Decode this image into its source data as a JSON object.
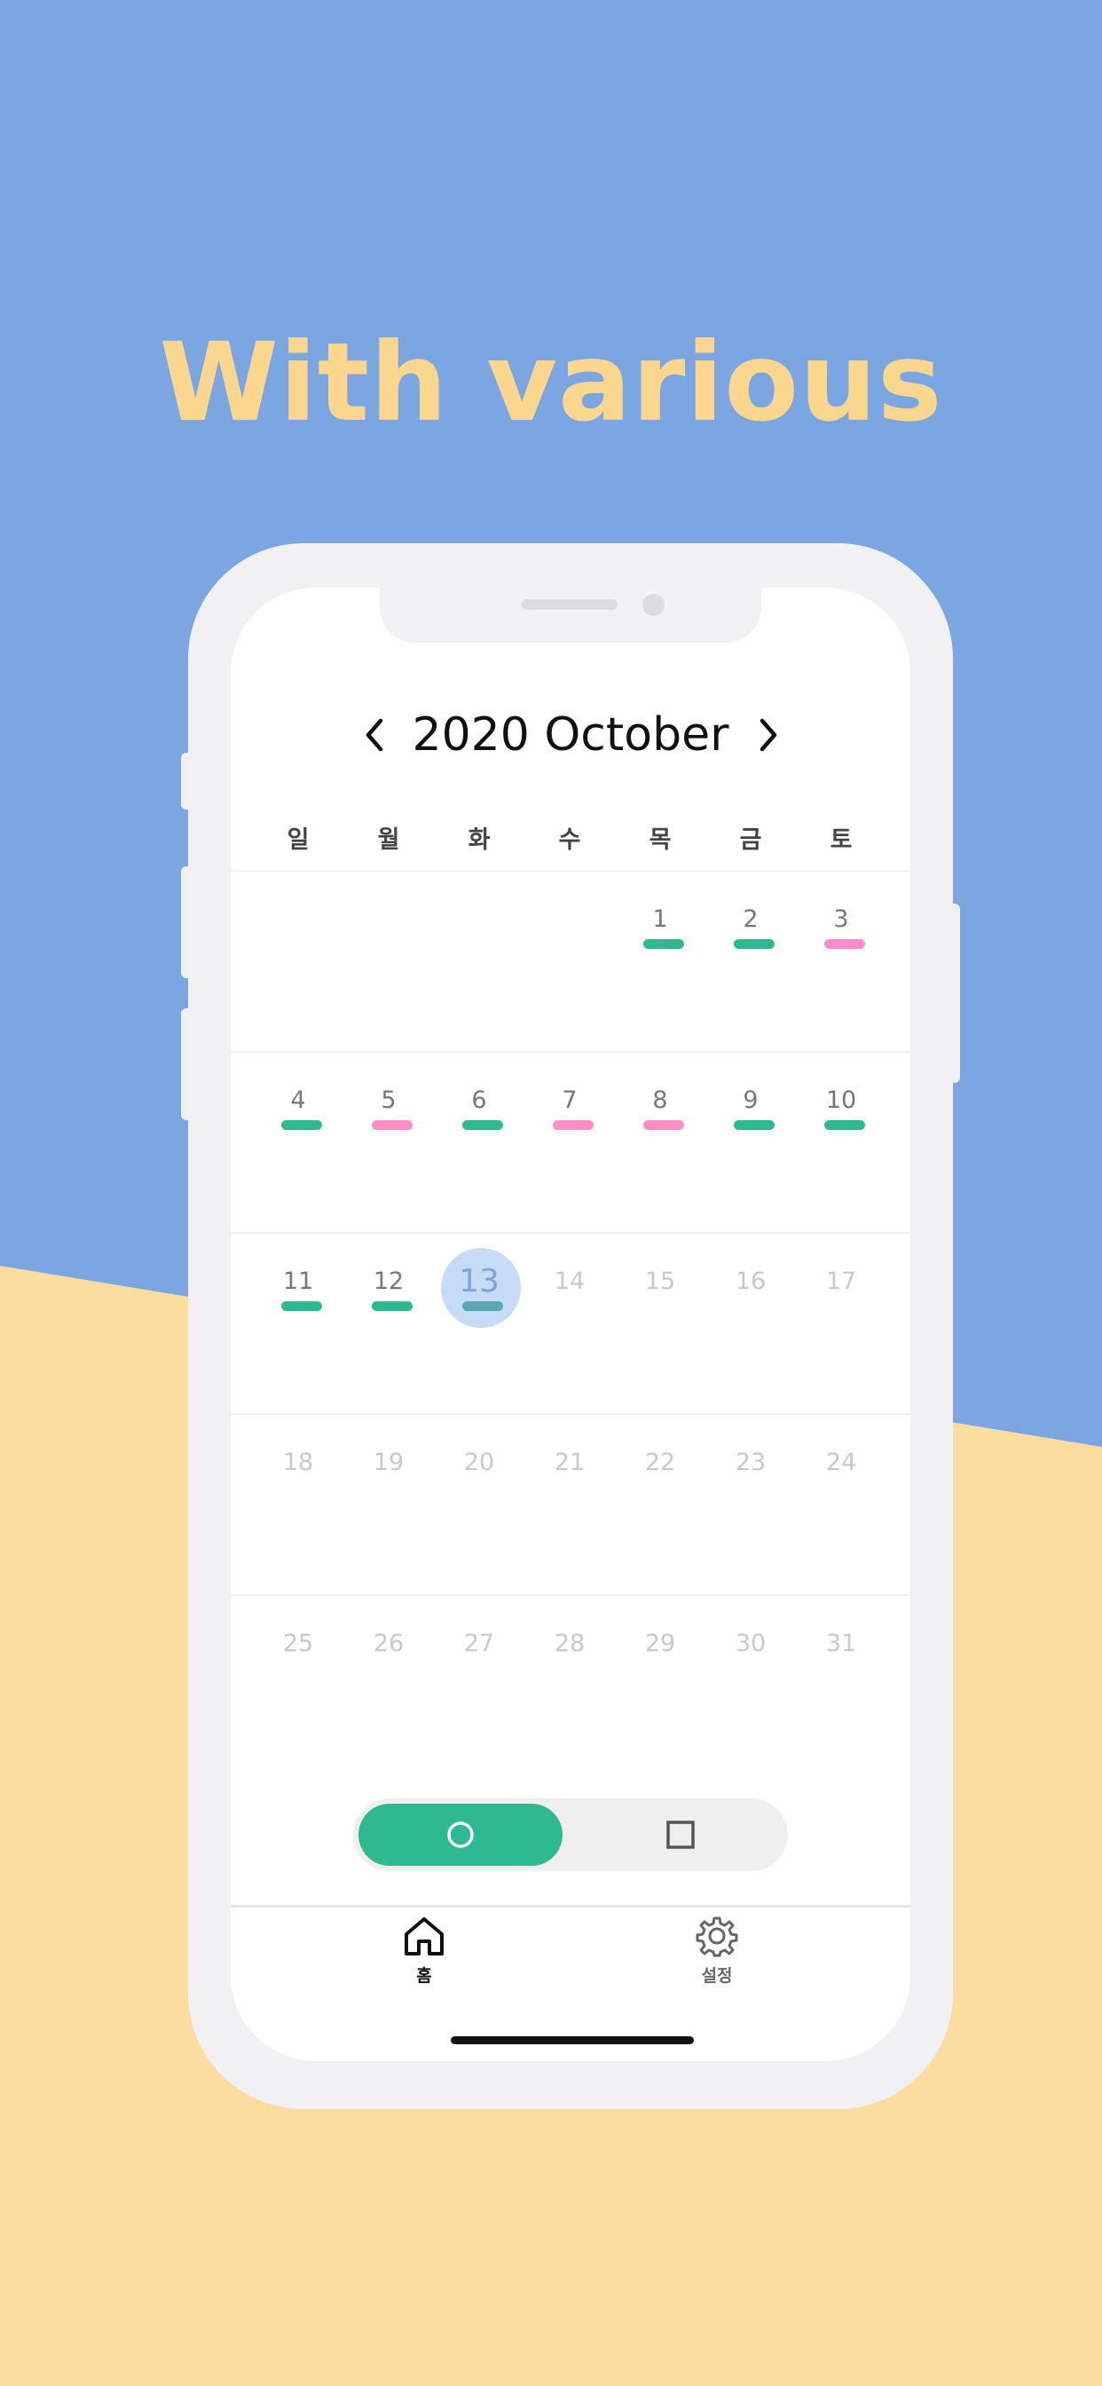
{
  "headline": "With various",
  "calendar": {
    "month_title": "2020 October",
    "weekdays": [
      "일",
      "월",
      "화",
      "수",
      "목",
      "금",
      "토"
    ],
    "colors": {
      "green": "#2fb991",
      "pink": "#ff8ec8",
      "today": "#c6dbf6"
    },
    "weeks": [
      [
        {
          "n": ""
        },
        {
          "n": ""
        },
        {
          "n": ""
        },
        {
          "n": ""
        },
        {
          "n": "1",
          "mark": "green"
        },
        {
          "n": "2",
          "mark": "green"
        },
        {
          "n": "3",
          "mark": "pink"
        }
      ],
      [
        {
          "n": "4",
          "mark": "green"
        },
        {
          "n": "5",
          "mark": "pink"
        },
        {
          "n": "6",
          "mark": "green"
        },
        {
          "n": "7",
          "mark": "pink"
        },
        {
          "n": "8",
          "mark": "pink"
        },
        {
          "n": "9",
          "mark": "green"
        },
        {
          "n": "10",
          "mark": "green"
        }
      ],
      [
        {
          "n": "11",
          "mark": "green"
        },
        {
          "n": "12",
          "mark": "green"
        },
        {
          "n": "13",
          "mark": "green",
          "today": true
        },
        {
          "n": "14",
          "future": true
        },
        {
          "n": "15",
          "future": true
        },
        {
          "n": "16",
          "future": true
        },
        {
          "n": "17",
          "future": true
        }
      ],
      [
        {
          "n": "18",
          "future": true
        },
        {
          "n": "19",
          "future": true
        },
        {
          "n": "20",
          "future": true
        },
        {
          "n": "21",
          "future": true
        },
        {
          "n": "22",
          "future": true
        },
        {
          "n": "23",
          "future": true
        },
        {
          "n": "24",
          "future": true
        }
      ],
      [
        {
          "n": "25",
          "future": true
        },
        {
          "n": "26",
          "future": true
        },
        {
          "n": "27",
          "future": true
        },
        {
          "n": "28",
          "future": true
        },
        {
          "n": "29",
          "future": true
        },
        {
          "n": "30",
          "future": true
        },
        {
          "n": "31",
          "future": true
        }
      ]
    ]
  },
  "toggle": {
    "selected": "circle",
    "options": [
      "circle-icon",
      "square-icon"
    ]
  },
  "tabbar": {
    "home_label": "홈",
    "settings_label": "설정",
    "home_icon": "home-icon",
    "settings_icon": "gear-icon"
  }
}
